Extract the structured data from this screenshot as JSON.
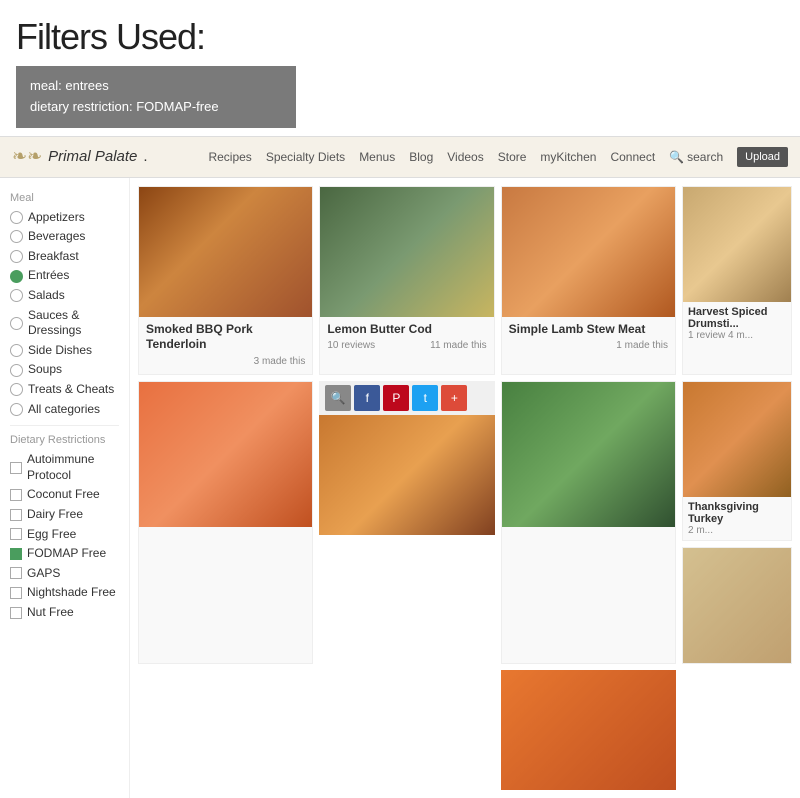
{
  "header": {
    "title": "Filters Used:",
    "filter1": "meal: entrees",
    "filter2": "dietary restriction: FODMAP-free"
  },
  "navbar": {
    "brand": "Primal Palate",
    "brand_icon": "❧",
    "links": [
      "Recipes",
      "Specialty Diets",
      "Menus",
      "Blog",
      "Videos",
      "Store",
      "myKitchen",
      "Connect"
    ],
    "search_label": "search",
    "upload_label": "Upload"
  },
  "sidebar": {
    "meal_section": "Meal",
    "meal_items": [
      {
        "label": "Appetizers",
        "active": false
      },
      {
        "label": "Beverages",
        "active": false
      },
      {
        "label": "Breakfast",
        "active": false
      },
      {
        "label": "Entrées",
        "active": true
      },
      {
        "label": "Salads",
        "active": false
      },
      {
        "label": "Sauces & Dressings",
        "active": false
      },
      {
        "label": "Side Dishes",
        "active": false
      },
      {
        "label": "Soups",
        "active": false
      },
      {
        "label": "Treats & Cheats",
        "active": false
      },
      {
        "label": "All categories",
        "active": false
      }
    ],
    "dietary_section": "Dietary Restrictions",
    "dietary_items": [
      {
        "label": "Autoimmune Protocol",
        "active": false
      },
      {
        "label": "Coconut Free",
        "active": false
      },
      {
        "label": "Dairy Free",
        "active": false
      },
      {
        "label": "Egg Free",
        "active": false
      },
      {
        "label": "FODMAP Free",
        "active": true
      },
      {
        "label": "GAPS",
        "active": false
      },
      {
        "label": "Nightshade Free",
        "active": false
      },
      {
        "label": "Nut Free",
        "active": false
      }
    ]
  },
  "recipes": [
    {
      "id": "bbq-pork",
      "title": "Smoked BBQ Pork Tenderloin",
      "reviews": "",
      "made": "3 made this",
      "img_class": "img-bbq"
    },
    {
      "id": "lemon-cod",
      "title": "Lemon Butter Cod",
      "reviews": "10 reviews",
      "made": "11 made this",
      "img_class": "img-cod"
    },
    {
      "id": "lamb-stew",
      "title": "Simple Lamb Stew Meat",
      "reviews": "",
      "made": "1 made this",
      "img_class": "img-lamb"
    },
    {
      "id": "salmon",
      "title": "",
      "reviews": "",
      "made": "",
      "img_class": "img-salmon"
    },
    {
      "id": "pizza",
      "title": "",
      "reviews": "",
      "made": "",
      "img_class": "img-pizza"
    },
    {
      "id": "green-veg",
      "title": "",
      "reviews": "",
      "made": "",
      "img_class": "img-green"
    }
  ],
  "right_col_recipes": [
    {
      "id": "harvest",
      "title": "Harvest Spiced Drumsti...",
      "reviews": "1 review",
      "made": "4 m...",
      "img_class": "img-harvest"
    },
    {
      "id": "turkey",
      "title": "Thanksgiving Turkey",
      "reviews": "",
      "made": "2 m...",
      "img_class": "img-turkey"
    },
    {
      "id": "side4",
      "title": "",
      "reviews": "",
      "made": "",
      "img_class": "img-side4"
    }
  ],
  "share": {
    "buttons": [
      "🔍",
      "f",
      "P",
      "t",
      "+"
    ]
  }
}
